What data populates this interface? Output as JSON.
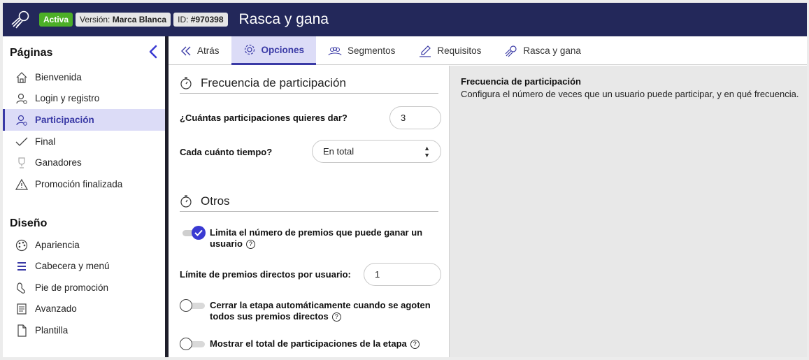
{
  "header": {
    "status_badge": "Activa",
    "version_label": "Versión:",
    "version_value": "Marca Blanca",
    "id_label": "ID:",
    "id_value": "#970398",
    "title": "Rasca y gana"
  },
  "sidebar": {
    "pages_title": "Páginas",
    "pages": [
      {
        "label": "Bienvenida",
        "icon": "home-icon"
      },
      {
        "label": "Login y registro",
        "icon": "user-icon"
      },
      {
        "label": "Participación",
        "icon": "user-settings-icon"
      },
      {
        "label": "Final",
        "icon": "check-icon"
      },
      {
        "label": "Ganadores",
        "icon": "trophy-icon"
      },
      {
        "label": "Promoción finalizada",
        "icon": "warning-icon"
      }
    ],
    "design_title": "Diseño",
    "design": [
      {
        "label": "Apariencia",
        "icon": "palette-icon"
      },
      {
        "label": "Cabecera y menú",
        "icon": "menu-icon"
      },
      {
        "label": "Pie de promoción",
        "icon": "foot-icon"
      },
      {
        "label": "Avanzado",
        "icon": "scroll-icon"
      },
      {
        "label": "Plantilla",
        "icon": "file-icon"
      }
    ],
    "active_index": 2
  },
  "tabs": [
    {
      "label": "Atrás",
      "icon": "double-chevron-left-icon"
    },
    {
      "label": "Opciones",
      "icon": "gear-icon"
    },
    {
      "label": "Segmentos",
      "icon": "group-icon"
    },
    {
      "label": "Requisitos",
      "icon": "pen-icon"
    },
    {
      "label": "Rasca y gana",
      "icon": "rocket-icon"
    }
  ],
  "form": {
    "section1_title": "Frecuencia de participación",
    "q1_label": "¿Cuántas participaciones quieres dar?",
    "q1_value": "3",
    "q2_label": "Cada cuánto tiempo?",
    "q2_value": "En total",
    "section2_title": "Otros",
    "toggle1_label_line1": "Limita el número de premios que puede ganar un",
    "toggle1_label_line2": "usuario",
    "toggle1_on": true,
    "limit_label": "Límite de premios directos por usuario:",
    "limit_value": "1",
    "toggle2_label_line1": "Cerrar la etapa automáticamente cuando se agoten",
    "toggle2_label_line2": "todos sus premios directos",
    "toggle2_on": false,
    "toggle3_label": "Mostrar el total de participaciones de la etapa",
    "toggle3_on": false,
    "help_mark": "?"
  },
  "help": {
    "title": "Frecuencia de participación",
    "text": "Configura el número de veces que un usuario puede participar, y en qué frecuencia."
  },
  "colors": {
    "header_bg": "#23285a",
    "accent": "#3a3aa6",
    "active_bg": "#dcdcf7",
    "badge_active": "#4caf27"
  }
}
